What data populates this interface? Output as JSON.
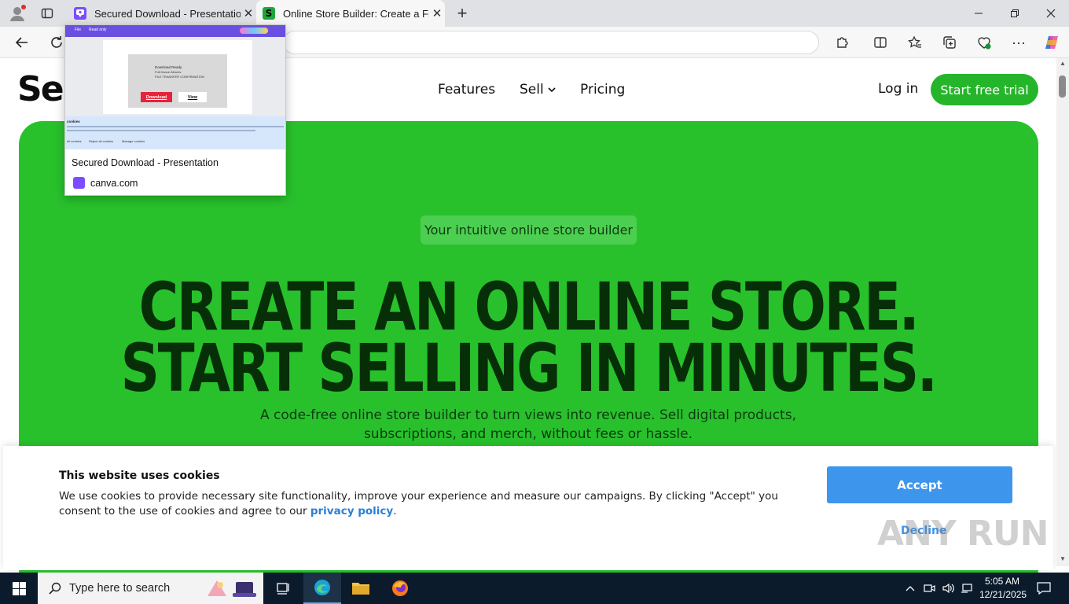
{
  "browser": {
    "tabs": [
      {
        "title": "Secured Download - Presentation",
        "active": false
      },
      {
        "title": "Online Store Builder: Create a Free",
        "active": true
      }
    ],
    "preview": {
      "title": "Secured Download - Presentation",
      "domain": "canva.com",
      "thumb": {
        "menu": [
          "File",
          "Read only"
        ],
        "doc_title": "Download Ready",
        "doc_lines": [
          "Full Dance Albums",
          "FILE TRANSFER CONFIRMATION"
        ],
        "download": "Download",
        "view": "View",
        "cookies_heading": "cookies",
        "cookie_buttons": [
          "all cookies",
          "Reject all cookies",
          "Manage cookies"
        ]
      }
    }
  },
  "site": {
    "logo": "Sel",
    "nav": {
      "features": "Features",
      "sell": "Sell",
      "pricing": "Pricing",
      "login": "Log in",
      "trial": "Start free trial"
    },
    "hero": {
      "pill": "Your intuitive online store builder",
      "line1": "CREATE AN ONLINE STORE.",
      "line2": "START SELLING IN MINUTES.",
      "sub": "A code-free online store builder to turn views into revenue. Sell digital products, subscriptions, and merch, without fees or hassle."
    }
  },
  "cookie": {
    "title": "This website uses cookies",
    "text": "We use cookies to provide necessary site functionality, improve your experience and measure our campaigns. By clicking \"Accept\" you consent to the use of cookies and agree to our",
    "link": "privacy policy",
    "period": ".",
    "accept": "Accept",
    "decline": "Decline"
  },
  "watermark": "ANY RUN",
  "taskbar": {
    "search_placeholder": "Type here to search",
    "time": "5:05 AM",
    "date": "12/21/2025"
  },
  "colors": {
    "hero_green": "#28c12c",
    "accent_blue": "#3d95ec",
    "cta_green": "#25b52a"
  }
}
